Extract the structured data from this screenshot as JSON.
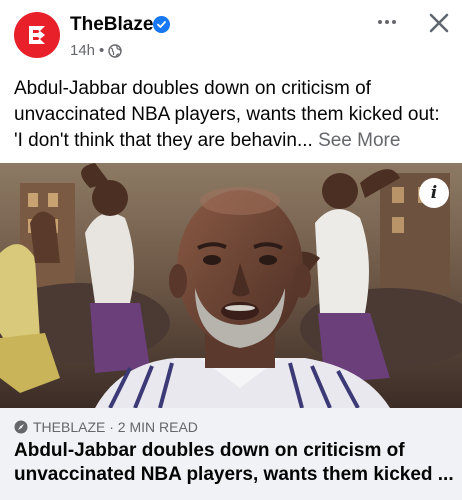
{
  "header": {
    "page_name": "TheBlaze",
    "time": "14h",
    "separator": "•",
    "avatar_icon": "theblaze-logo-icon",
    "verified_icon": "verified-badge-icon",
    "privacy_icon": "globe-icon",
    "more_icon": "more-options-icon",
    "close_icon": "close-icon"
  },
  "post": {
    "caption": "Abdul-Jabbar doubles down on criticism of unvaccinated NBA players, wants them kicked out: 'I don't think that they are behavin...",
    "see_more": "See More"
  },
  "media": {
    "info_label": "i",
    "image_icon": "video-thumbnail-image"
  },
  "link_card": {
    "source": "THEBLAZE · 2 MIN READ",
    "source_icon": "compass-icon",
    "title": "Abdul-Jabbar doubles down on criticism of unvaccinated NBA players, wants them kicked ..."
  },
  "colors": {
    "brand": "#e8202a",
    "verified": "#1877f2",
    "secondary_text": "#65676b",
    "card_bg": "#f0f2f5"
  }
}
